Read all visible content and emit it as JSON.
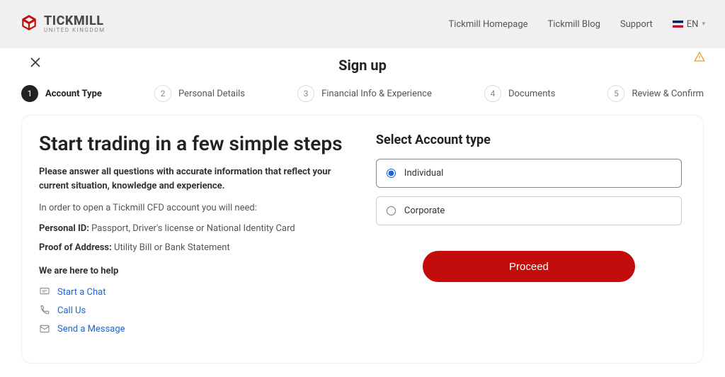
{
  "brand": {
    "name": "TICKMILL",
    "region": "UNITED KINGDOM"
  },
  "nav": {
    "home": "Tickmill Homepage",
    "blog": "Tickmill Blog",
    "support": "Support",
    "lang": "EN"
  },
  "page": {
    "title": "Sign up"
  },
  "steps": [
    {
      "num": "1",
      "label": "Account Type"
    },
    {
      "num": "2",
      "label": "Personal Details"
    },
    {
      "num": "3",
      "label": "Financial Info & Experience"
    },
    {
      "num": "4",
      "label": "Documents"
    },
    {
      "num": "5",
      "label": "Review & Confirm"
    }
  ],
  "intro": {
    "heading": "Start trading in a few simple steps",
    "lead": "Please answer all questions with accurate information that reflect your current situation, knowledge and experience.",
    "need": "In order to open a Tickmill CFD account you will need:",
    "personal_id_label": "Personal ID:",
    "personal_id_value": "Passport, Driver's license or National Identity Card",
    "proof_label": "Proof of Address:",
    "proof_value": "Utility Bill or Bank Statement",
    "help_heading": "We are here to help",
    "help": {
      "chat": "Start a Chat",
      "call": "Call Us",
      "msg": "Send a Message"
    }
  },
  "form": {
    "heading": "Select Account type",
    "options": {
      "individual": "Individual",
      "corporate": "Corporate"
    },
    "selected": "individual",
    "proceed": "Proceed"
  }
}
